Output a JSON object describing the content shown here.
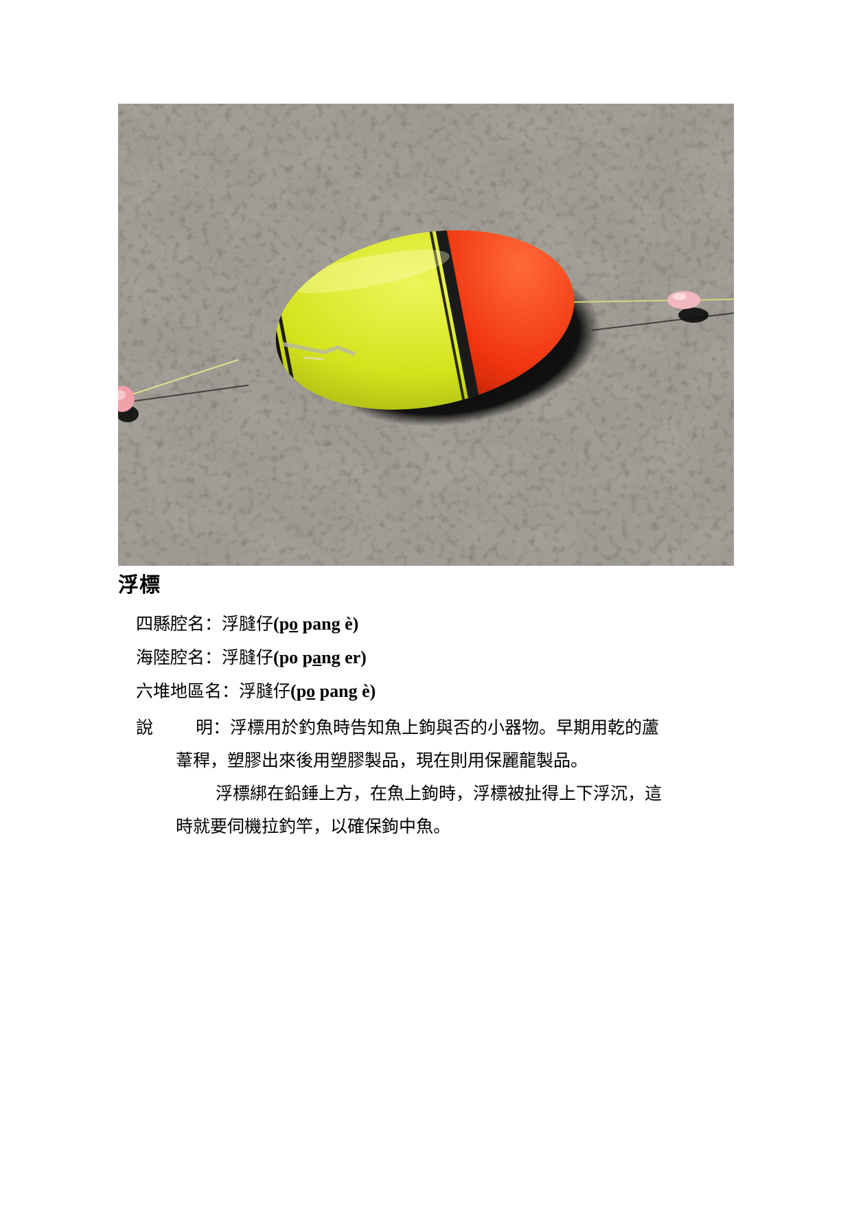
{
  "document": {
    "title": "浮標",
    "names": [
      {
        "label": "四縣腔名：",
        "hanzi": "浮膖仔",
        "rom_open": "(p",
        "rom_u": "o",
        "rom_close": " pang è)"
      },
      {
        "label": "海陸腔名：",
        "hanzi": "浮膖仔",
        "rom_open": "(po p",
        "rom_u": "a",
        "rom_close": "ng er)"
      },
      {
        "label": "六堆地區名：",
        "hanzi": "浮膖仔",
        "rom_open": "(p",
        "rom_u": "o",
        "rom_close": " pang è)"
      }
    ],
    "description": {
      "label_1": "說",
      "label_2": "明：",
      "line_1": "浮標用於釣魚時告知魚上鉤與否的小器物。早期用乾的蘆",
      "line_2": "葦稈，塑膠出來後用塑膠製品，現在則用保麗龍製品。",
      "line_3": "浮標綁在鉛錘上方，在魚上鉤時，浮標被扯得上下浮沉，這",
      "line_4": "時就要伺機拉釣竿，以確保鉤中魚。"
    }
  },
  "photo": {
    "subject": "fishing-float",
    "colors": {
      "float_yellow": "#d6e61a",
      "float_red": "#f0350f",
      "float_black": "#1a1a1a",
      "rock": "#8a857c",
      "bead": "#f2a0a8"
    }
  }
}
